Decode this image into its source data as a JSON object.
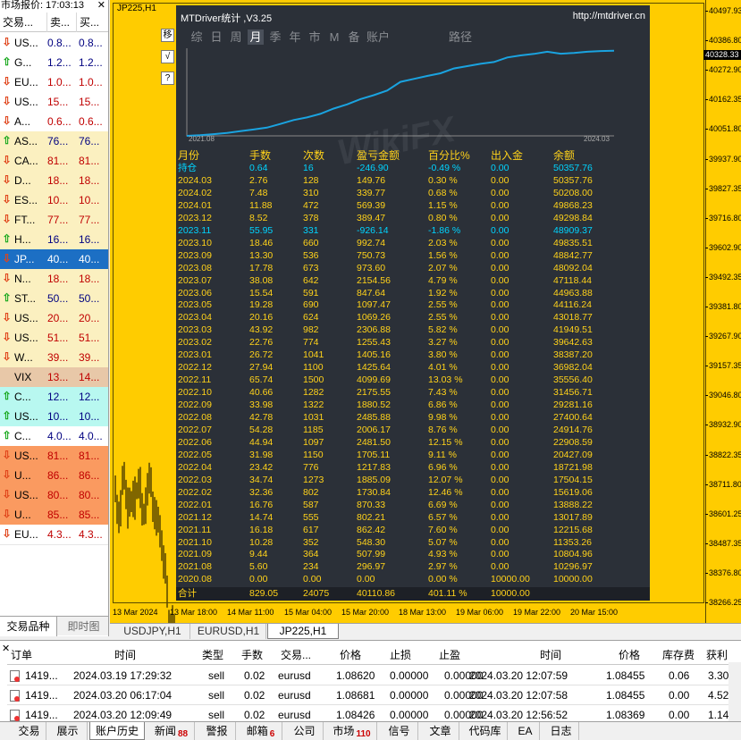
{
  "market_watch": {
    "title": "市场报价: 17:03:13",
    "close": "✕",
    "col_symbol": "交易...",
    "col_bid": "卖...",
    "col_ask": "买...",
    "rows": [
      {
        "sym": "US...",
        "bid": "0.8...",
        "ask": "0.8...",
        "dir": "dn",
        "bg": "#ffffff",
        "color": "#000080"
      },
      {
        "sym": "G...",
        "bid": "1.2...",
        "ask": "1.2...",
        "dir": "up",
        "bg": "#ffffff",
        "color": "#000080"
      },
      {
        "sym": "EU...",
        "bid": "1.0...",
        "ask": "1.0...",
        "dir": "dn",
        "bg": "#ffffff",
        "color": "#c00000"
      },
      {
        "sym": "US...",
        "bid": "15...",
        "ask": "15...",
        "dir": "dn",
        "bg": "#ffffff",
        "color": "#c00000"
      },
      {
        "sym": "A...",
        "bid": "0.6...",
        "ask": "0.6...",
        "dir": "dn",
        "bg": "#ffffff",
        "color": "#c00000"
      },
      {
        "sym": "AS...",
        "bid": "76...",
        "ask": "76...",
        "dir": "up",
        "bg": "#fbf0c0",
        "color": "#000080"
      },
      {
        "sym": "CA...",
        "bid": "81...",
        "ask": "81...",
        "dir": "dn",
        "bg": "#fbf0c0",
        "color": "#c00000"
      },
      {
        "sym": "D...",
        "bid": "18...",
        "ask": "18...",
        "dir": "dn",
        "bg": "#fbf0c0",
        "color": "#c00000"
      },
      {
        "sym": "ES...",
        "bid": "10...",
        "ask": "10...",
        "dir": "dn",
        "bg": "#fbf0c0",
        "color": "#c00000"
      },
      {
        "sym": "FT...",
        "bid": "77...",
        "ask": "77...",
        "dir": "dn",
        "bg": "#fbf0c0",
        "color": "#c00000"
      },
      {
        "sym": "H...",
        "bid": "16...",
        "ask": "16...",
        "dir": "up",
        "bg": "#fbf0c0",
        "color": "#000080"
      },
      {
        "sym": "JP...",
        "bid": "40...",
        "ask": "40...",
        "dir": "dn",
        "bg": "#1c6fc4",
        "color": "#ffffff"
      },
      {
        "sym": "N...",
        "bid": "18...",
        "ask": "18...",
        "dir": "dn",
        "bg": "#fbf0c0",
        "color": "#c00000"
      },
      {
        "sym": "ST...",
        "bid": "50...",
        "ask": "50...",
        "dir": "up",
        "bg": "#fbf0c0",
        "color": "#000080"
      },
      {
        "sym": "US...",
        "bid": "20...",
        "ask": "20...",
        "dir": "dn",
        "bg": "#fbf0c0",
        "color": "#c00000"
      },
      {
        "sym": "US...",
        "bid": "51...",
        "ask": "51...",
        "dir": "dn",
        "bg": "#fbf0c0",
        "color": "#c00000"
      },
      {
        "sym": "W...",
        "bid": "39...",
        "ask": "39...",
        "dir": "dn",
        "bg": "#fbf0c0",
        "color": "#c00000"
      },
      {
        "sym": "VIX",
        "bid": "13...",
        "ask": "14...",
        "dir": "none",
        "bg": "#e8c8a8",
        "color": "#c00000"
      },
      {
        "sym": "C...",
        "bid": "12...",
        "ask": "12...",
        "dir": "up",
        "bg": "#b8f8f0",
        "color": "#000080"
      },
      {
        "sym": "US...",
        "bid": "10...",
        "ask": "10...",
        "dir": "up",
        "bg": "#b8f8f0",
        "color": "#000080"
      },
      {
        "sym": "C...",
        "bid": "4.0...",
        "ask": "4.0...",
        "dir": "up",
        "bg": "#ffffff",
        "color": "#000080"
      },
      {
        "sym": "US...",
        "bid": "81...",
        "ask": "81...",
        "dir": "dn",
        "bg": "#fa9a60",
        "color": "#c00000"
      },
      {
        "sym": "U...",
        "bid": "86...",
        "ask": "86...",
        "dir": "dn",
        "bg": "#fa9a60",
        "color": "#c00000"
      },
      {
        "sym": "US...",
        "bid": "80...",
        "ask": "80...",
        "dir": "dn",
        "bg": "#fa9a60",
        "color": "#c00000"
      },
      {
        "sym": "U...",
        "bid": "85...",
        "ask": "85...",
        "dir": "dn",
        "bg": "#fa9a60",
        "color": "#c00000"
      },
      {
        "sym": "EU...",
        "bid": "4.3...",
        "ask": "4.3...",
        "dir": "dn",
        "bg": "#ffffff",
        "color": "#c00000"
      }
    ],
    "tabs": [
      "交易品种",
      "即时图"
    ]
  },
  "chart": {
    "symbol": "JP225,H1",
    "current_price": "40328.33",
    "price_ticks": [
      "40497.93",
      "40386.80",
      "40272.90",
      "40162.35",
      "40051.80",
      "39937.90",
      "39827.35",
      "39716.80",
      "39602.90",
      "39492.35",
      "39381.80",
      "39267.90",
      "39157.35",
      "39046.80",
      "38932.90",
      "38822.35",
      "38711.80",
      "38601.25",
      "38487.35",
      "38376.80",
      "38266.25"
    ],
    "time_ticks": [
      "13 Mar 2024",
      "13 Mar 18:00",
      "14 Mar 11:00",
      "15 Mar 04:00",
      "15 Mar 20:00",
      "18 Mar 13:00",
      "19 Mar 06:00",
      "19 Mar 22:00",
      "20 Mar 15:00"
    ],
    "side_buttons": [
      "移",
      "√",
      "?"
    ],
    "tabs": [
      "USDJPY,H1",
      "EURUSD,H1",
      "JP225,H1"
    ]
  },
  "panel": {
    "title": "MTDriver统计 ,V3.25",
    "url": "http://mtdriver.cn",
    "tabs": [
      "综",
      "日",
      "周",
      "月",
      "季",
      "年",
      "市",
      "M",
      "备",
      "账户",
      "路径"
    ],
    "active_tab": "月",
    "equity_start_label": "2021.08",
    "equity_end_label": "2024.03",
    "watermark": "WikiFX",
    "headers": [
      "月份",
      "手数",
      "次数",
      "盈亏金额",
      "百分比%",
      "出入金",
      "余额"
    ],
    "rows": [
      [
        "持仓",
        "0.64",
        "16",
        "-246.90",
        "-0.49 %",
        "0.00",
        "50357.76"
      ],
      [
        "2024.03",
        "2.76",
        "128",
        "149.76",
        "0.30 %",
        "0.00",
        "50357.76"
      ],
      [
        "2024.02",
        "7.48",
        "310",
        "339.77",
        "0.68 %",
        "0.00",
        "50208.00"
      ],
      [
        "2024.01",
        "11.88",
        "472",
        "569.39",
        "1.15 %",
        "0.00",
        "49868.23"
      ],
      [
        "2023.12",
        "8.52",
        "378",
        "389.47",
        "0.80 %",
        "0.00",
        "49298.84"
      ],
      [
        "2023.11",
        "55.95",
        "331",
        "-926.14",
        "-1.86 %",
        "0.00",
        "48909.37"
      ],
      [
        "2023.10",
        "18.46",
        "660",
        "992.74",
        "2.03 %",
        "0.00",
        "49835.51"
      ],
      [
        "2023.09",
        "13.30",
        "536",
        "750.73",
        "1.56 %",
        "0.00",
        "48842.77"
      ],
      [
        "2023.08",
        "17.78",
        "673",
        "973.60",
        "2.07 %",
        "0.00",
        "48092.04"
      ],
      [
        "2023.07",
        "38.08",
        "642",
        "2154.56",
        "4.79 %",
        "0.00",
        "47118.44"
      ],
      [
        "2023.06",
        "15.54",
        "591",
        "847.64",
        "1.92 %",
        "0.00",
        "44963.88"
      ],
      [
        "2023.05",
        "19.28",
        "690",
        "1097.47",
        "2.55 %",
        "0.00",
        "44116.24"
      ],
      [
        "2023.04",
        "20.16",
        "624",
        "1069.26",
        "2.55 %",
        "0.00",
        "43018.77"
      ],
      [
        "2023.03",
        "43.92",
        "982",
        "2306.88",
        "5.82 %",
        "0.00",
        "41949.51"
      ],
      [
        "2023.02",
        "22.76",
        "774",
        "1255.43",
        "3.27 %",
        "0.00",
        "39642.63"
      ],
      [
        "2023.01",
        "26.72",
        "1041",
        "1405.16",
        "3.80 %",
        "0.00",
        "38387.20"
      ],
      [
        "2022.12",
        "27.94",
        "1100",
        "1425.64",
        "4.01 %",
        "0.00",
        "36982.04"
      ],
      [
        "2022.11",
        "65.74",
        "1500",
        "4099.69",
        "13.03 %",
        "0.00",
        "35556.40"
      ],
      [
        "2022.10",
        "40.66",
        "1282",
        "2175.55",
        "7.43 %",
        "0.00",
        "31456.71"
      ],
      [
        "2022.09",
        "33.98",
        "1322",
        "1880.52",
        "6.86 %",
        "0.00",
        "29281.16"
      ],
      [
        "2022.08",
        "42.78",
        "1031",
        "2485.88",
        "9.98 %",
        "0.00",
        "27400.64"
      ],
      [
        "2022.07",
        "54.28",
        "1185",
        "2006.17",
        "8.76 %",
        "0.00",
        "24914.76"
      ],
      [
        "2022.06",
        "44.94",
        "1097",
        "2481.50",
        "12.15 %",
        "0.00",
        "22908.59"
      ],
      [
        "2022.05",
        "31.98",
        "1150",
        "1705.11",
        "9.11 %",
        "0.00",
        "20427.09"
      ],
      [
        "2022.04",
        "23.42",
        "776",
        "1217.83",
        "6.96 %",
        "0.00",
        "18721.98"
      ],
      [
        "2022.03",
        "34.74",
        "1273",
        "1885.09",
        "12.07 %",
        "0.00",
        "17504.15"
      ],
      [
        "2022.02",
        "32.36",
        "802",
        "1730.84",
        "12.46 %",
        "0.00",
        "15619.06"
      ],
      [
        "2022.01",
        "16.76",
        "587",
        "870.33",
        "6.69 %",
        "0.00",
        "13888.22"
      ],
      [
        "2021.12",
        "14.74",
        "555",
        "802.21",
        "6.57 %",
        "0.00",
        "13017.89"
      ],
      [
        "2021.11",
        "16.18",
        "617",
        "862.42",
        "7.60 %",
        "0.00",
        "12215.68"
      ],
      [
        "2021.10",
        "10.28",
        "352",
        "548.30",
        "5.07 %",
        "0.00",
        "11353.26"
      ],
      [
        "2021.09",
        "9.44",
        "364",
        "507.99",
        "4.93 %",
        "0.00",
        "10804.96"
      ],
      [
        "2021.08",
        "5.60",
        "234",
        "296.97",
        "2.97 %",
        "0.00",
        "10296.97"
      ],
      [
        "2020.08",
        "0.00",
        "0.00",
        "0.00",
        "0.00 %",
        "10000.00",
        "10000.00"
      ]
    ],
    "highlight_rows": [
      0,
      5
    ],
    "total": [
      "合计",
      "829.05",
      "24075",
      "40110.86",
      "401.11 %",
      "10000.00",
      ""
    ]
  },
  "terminal": {
    "close": "✕",
    "headers": [
      "订单",
      "时间",
      "类型",
      "手数",
      "交易...",
      "价格",
      "止损",
      "止盈",
      "时间",
      "价格",
      "库存费",
      "获利"
    ],
    "rows": [
      [
        "1419...",
        "2024.03.19 17:29:32",
        "sell",
        "0.02",
        "eurusd",
        "1.08620",
        "0.00000",
        "0.00000",
        "2024.03.20 12:07:59",
        "1.08455",
        "0.06",
        "3.30"
      ],
      [
        "1419...",
        "2024.03.20 06:17:04",
        "sell",
        "0.02",
        "eurusd",
        "1.08681",
        "0.00000",
        "0.00000",
        "2024.03.20 12:07:58",
        "1.08455",
        "0.00",
        "4.52"
      ],
      [
        "1419...",
        "2024.03.20 12:09:49",
        "sell",
        "0.02",
        "eurusd",
        "1.08426",
        "0.00000",
        "0.00000",
        "2024.03.20 12:56:52",
        "1.08369",
        "0.00",
        "1.14"
      ]
    ],
    "tabs": [
      {
        "label": "交易",
        "badge": ""
      },
      {
        "label": "展示",
        "badge": ""
      },
      {
        "label": "账户历史",
        "badge": ""
      },
      {
        "label": "新闻",
        "badge": "88"
      },
      {
        "label": "警报",
        "badge": ""
      },
      {
        "label": "邮箱",
        "badge": "6"
      },
      {
        "label": "公司",
        "badge": ""
      },
      {
        "label": "市场",
        "badge": "110"
      },
      {
        "label": "信号",
        "badge": ""
      },
      {
        "label": "文章",
        "badge": ""
      },
      {
        "label": "代码库",
        "badge": ""
      },
      {
        "label": "EA",
        "badge": ""
      },
      {
        "label": "日志",
        "badge": ""
      }
    ],
    "active_tab": "账户历史"
  },
  "colors": {
    "chart_bg": "#ffcc00",
    "panel_bg": "#2b3038",
    "panel_text": "#ffd21a",
    "panel_highlight": "#00d4ff",
    "equity_line": "#1aa3e0"
  }
}
